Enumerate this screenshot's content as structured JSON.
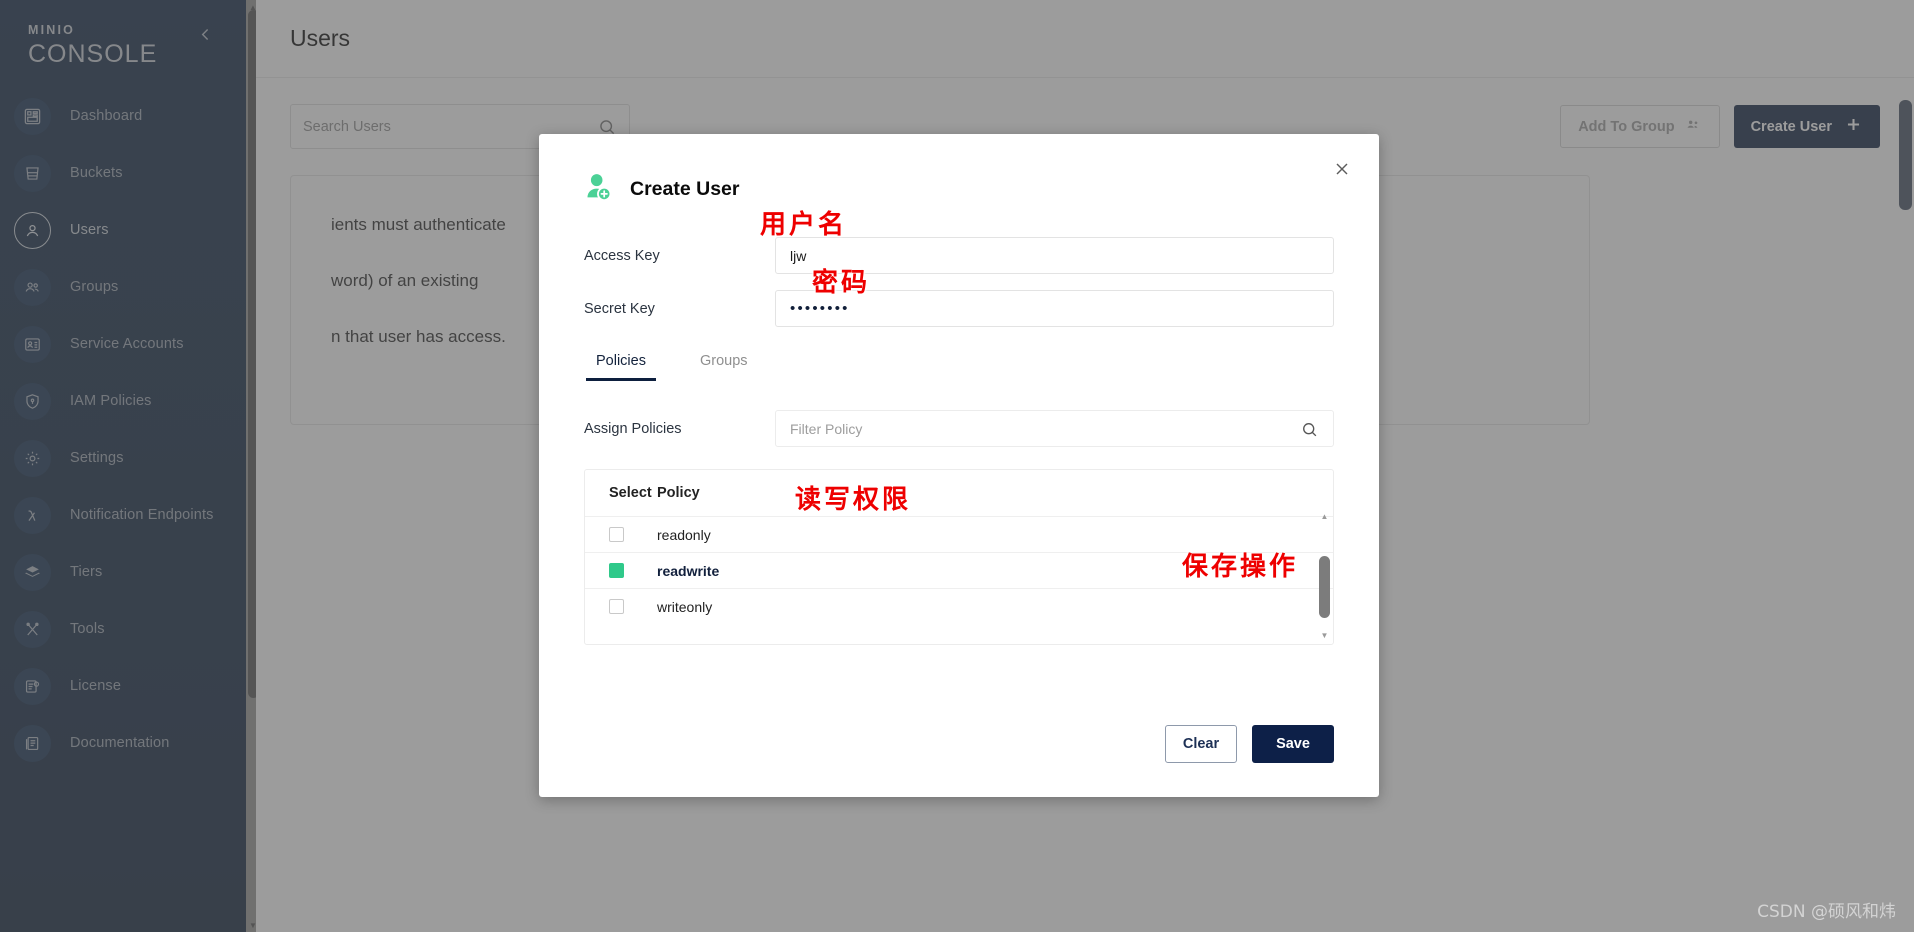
{
  "sidebar": {
    "logo_top": "MINIO",
    "logo_bottom": "CONSOLE",
    "collapse_icon": "chevron-left-icon",
    "items": [
      {
        "label": "Dashboard",
        "icon": "dashboard-icon",
        "active": false
      },
      {
        "label": "Buckets",
        "icon": "bucket-icon",
        "active": false
      },
      {
        "label": "Users",
        "icon": "user-icon",
        "active": true
      },
      {
        "label": "Groups",
        "icon": "groups-icon",
        "active": false
      },
      {
        "label": "Service Accounts",
        "icon": "id-card-icon",
        "active": false
      },
      {
        "label": "IAM Policies",
        "icon": "shield-icon",
        "active": false
      },
      {
        "label": "Settings",
        "icon": "gear-icon",
        "active": false
      },
      {
        "label": "Notification Endpoints",
        "icon": "lambda-icon",
        "active": false
      },
      {
        "label": "Tiers",
        "icon": "layers-icon",
        "active": false
      },
      {
        "label": "Tools",
        "icon": "tools-icon",
        "active": false
      },
      {
        "label": "License",
        "icon": "certificate-icon",
        "active": false
      },
      {
        "label": "Documentation",
        "icon": "book-icon",
        "active": false
      }
    ]
  },
  "page": {
    "title": "Users",
    "search_placeholder": "Search Users",
    "search_icon": "search-icon",
    "add_to_group_label": "Add To Group",
    "add_to_group_icon": "add-group-icon",
    "create_user_label": "Create User",
    "create_user_icon": "plus-icon",
    "info_line_1": "ients must authenticate",
    "info_line_2": "word) of an existing",
    "info_line_3": "n that user has access."
  },
  "modal": {
    "title": "Create User",
    "title_icon": "add-user-icon",
    "close_icon": "close-icon",
    "fields": [
      {
        "label": "Access Key",
        "value": "ljw",
        "name": "access-key"
      },
      {
        "label": "Secret Key",
        "value": "••••••••",
        "name": "secret-key"
      }
    ],
    "tabs": [
      {
        "label": "Policies",
        "active": true
      },
      {
        "label": "Groups",
        "active": false
      }
    ],
    "assign_policies_label": "Assign Policies",
    "filter_policy_placeholder": "Filter Policy",
    "filter_policy_value": "",
    "filter_icon": "search-icon",
    "policy_table": {
      "columns": [
        "Select",
        "Policy"
      ],
      "rows": [
        {
          "policy": "readonly",
          "checked": false
        },
        {
          "policy": "readwrite",
          "checked": true
        },
        {
          "policy": "writeonly",
          "checked": false
        }
      ]
    },
    "clear_label": "Clear",
    "save_label": "Save"
  },
  "annotations": {
    "username": "用户名",
    "password": "密码",
    "readwrite": "读写权限",
    "save": "保存操作"
  },
  "watermark": "CSDN @硕风和炜",
  "colors": {
    "sidebar_bg": "#081c3a",
    "accent_navy": "#0d2048",
    "checkbox_green": "#2fc98a",
    "annotation_red": "#ee0000"
  }
}
